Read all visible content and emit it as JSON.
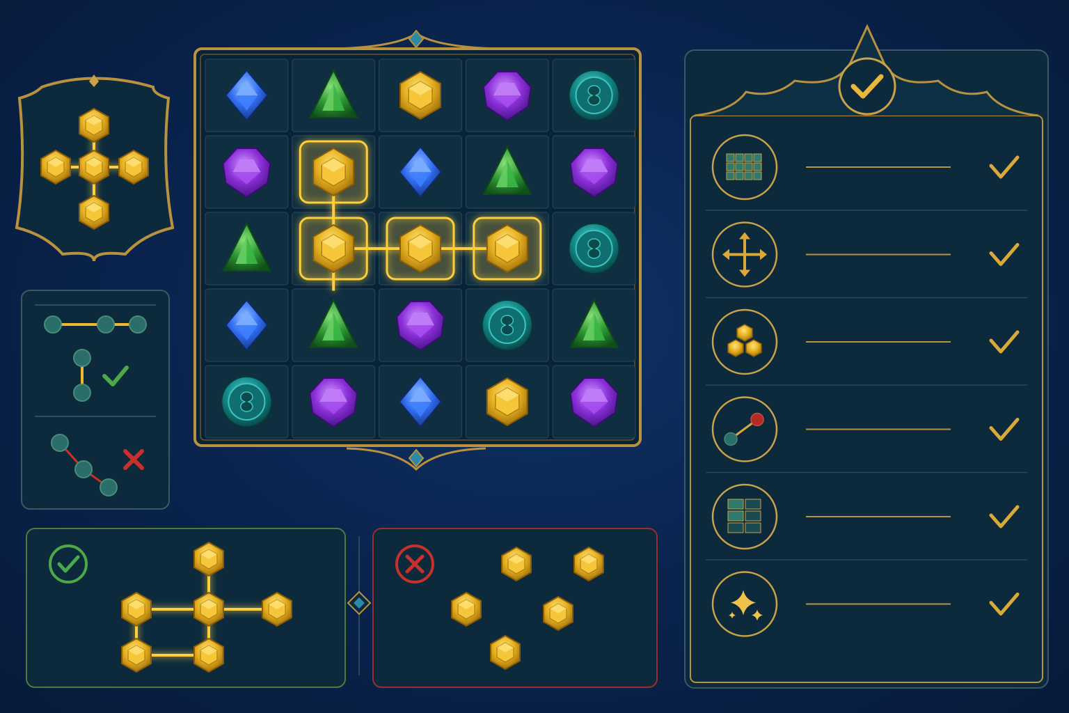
{
  "colors": {
    "background": "#0a2550",
    "panel": "#0c2a3c",
    "panel_border": "#b8923e",
    "gold_gem": "#e6b120",
    "blue_gem": "#2f6cf0",
    "green_gem": "#2f9a36",
    "purple_gem": "#8a2fd8",
    "teal_gem": "#138a8a",
    "valid": "#4ca94a",
    "invalid": "#c8302c",
    "path_glow": "#ffcf3a"
  },
  "board": {
    "rows": [
      [
        "blue",
        "green",
        "gold",
        "purple",
        "teal"
      ],
      [
        "purple",
        "gold",
        "blue",
        "green",
        "purple"
      ],
      [
        "green",
        "gold",
        "gold",
        "gold",
        "teal"
      ],
      [
        "blue",
        "green",
        "purple",
        "teal",
        "green"
      ],
      [
        "teal",
        "purple",
        "blue",
        "gold",
        "purple"
      ]
    ],
    "highlighted_path": [
      [
        1,
        1
      ],
      [
        2,
        1
      ],
      [
        2,
        2
      ],
      [
        2,
        3
      ]
    ]
  },
  "target_pattern": {
    "icon": "gold-plus-pattern-icon"
  },
  "rules": [
    {
      "icon": "grid-icon",
      "status": "check-icon"
    },
    {
      "icon": "move-arrows-icon",
      "status": "check-icon"
    },
    {
      "icon": "gem-cluster-icon",
      "status": "check-icon"
    },
    {
      "icon": "link-nodes-icon",
      "status": "check-icon"
    },
    {
      "icon": "partial-grid-icon",
      "status": "check-icon"
    },
    {
      "icon": "sparkle-icon",
      "status": "check-icon"
    }
  ],
  "examples": {
    "valid": {
      "icon": "check-circle-icon"
    },
    "invalid": {
      "icon": "x-circle-icon"
    }
  }
}
